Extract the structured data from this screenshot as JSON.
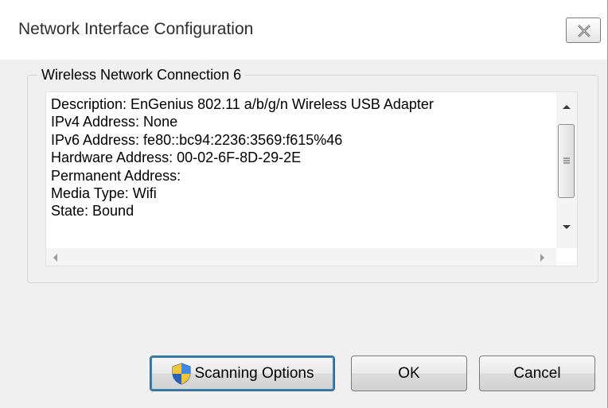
{
  "window": {
    "title": "Network Interface Configuration"
  },
  "group": {
    "label": "Wireless Network Connection 6"
  },
  "details": [
    "Description: EnGenius 802.11 a/b/g/n Wireless USB Adapter",
    "IPv4 Address: None",
    "IPv6 Address: fe80::bc94:2236:3569:f615%46",
    "Hardware Address: 00-02-6F-8D-29-2E",
    "Permanent Address:",
    "Media Type: Wifi",
    "State: Bound"
  ],
  "buttons": {
    "scanning_options": "Scanning Options",
    "ok": "OK",
    "cancel": "Cancel"
  },
  "icons": {
    "close": "close-icon",
    "shield": "uac-shield-icon"
  }
}
